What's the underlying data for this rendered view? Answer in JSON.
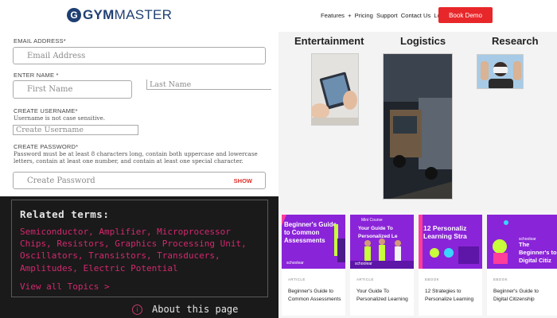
{
  "header": {
    "logo_mark": "G",
    "logo_strong": "GYM",
    "logo_rest": "MASTER",
    "nav": [
      "Features",
      "Pricing",
      "Support",
      "Contact Us",
      "Login"
    ],
    "cta": "Book Demo",
    "cta_color": "#e8272a"
  },
  "form": {
    "email_label": "EMAIL ADDRESS*",
    "email_placeholder": "Email Address",
    "name_label": "ENTER NAME *",
    "first_placeholder": "First Name",
    "last_placeholder": "Last Name",
    "username_label": "CREATE USERNAME*",
    "username_hint": "Username is not case sensitive.",
    "username_placeholder": "Create Username",
    "password_label": "CREATE PASSWORD*",
    "password_hint": "Password must be at least 8 characters long, contain both uppercase and lowercase letters, contain at least one number, and contain at least one special character.",
    "password_placeholder": "Create Password",
    "show_label": "SHOW"
  },
  "related": {
    "title": "Related terms:",
    "terms": "Semiconductor, Amplifier, Microprocessor Chips, Resistors, Graphics Processing Unit, Oscillators, Transistors, Transducers, Amplitudes, Electric Potential",
    "view_all": "View all Topics",
    "about": "About this page",
    "accent_color": "#d4286e"
  },
  "industries": [
    "Entertainment",
    "Logistics",
    "Research"
  ],
  "blog": {
    "accent_color": "#8a24d8",
    "cards": [
      {
        "banner": "Beginner's Guide to Common Assessments",
        "brand": "schoolear",
        "category": "ARTICLE",
        "title": "Beginner's Guide to Common Assessments"
      },
      {
        "banner": "Your Guide To Personalized Le",
        "brand": "schoolear",
        "category": "ARTICLE",
        "title": "Your Guide To Personalized Learning"
      },
      {
        "banner": "12 Personaliz Learning Stra",
        "brand": "",
        "category": "EBOOK",
        "title": "12 Strategies to Personalize Learning"
      },
      {
        "banner": "The Beginner's to Digital Citiz",
        "brand": "schoolear",
        "category": "EBOOK",
        "title": "Beginner's Guide to Digital Citizenship"
      }
    ]
  }
}
